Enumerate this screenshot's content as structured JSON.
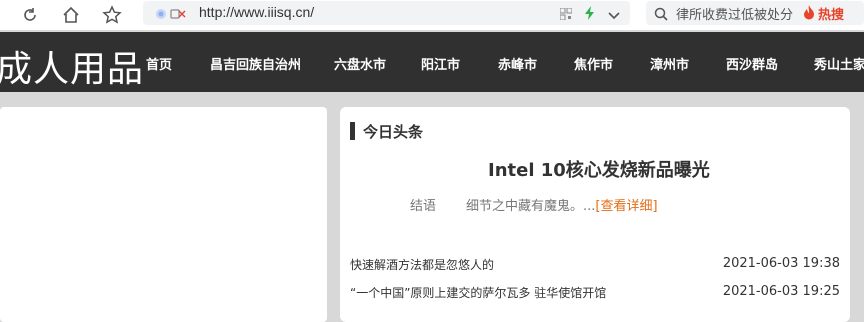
{
  "browser": {
    "url": "http://www.iiisq.cn/",
    "search_placeholder": "律所收费过低被处分",
    "hot_label": "热搜"
  },
  "site": {
    "logo": "成人用品",
    "nav": [
      "首页",
      "昌吉回族自治州",
      "六盘水市",
      "阳江市",
      "赤峰市",
      "焦作市",
      "漳州市",
      "西沙群岛",
      "秀山土家"
    ]
  },
  "news": {
    "section_title": "今日头条",
    "headline": "Intel 10核心发烧新品曝光",
    "author": "结语",
    "summary": "细节之中藏有魔鬼。...",
    "more_label": "[查看详细]",
    "items": [
      {
        "title": "快速解酒方法都是忽悠人的",
        "date": "2021-06-03 19:38"
      },
      {
        "title": "“一个中国”原则上建交的萨尔瓦多 驻华使馆开馆",
        "date": "2021-06-03 19:25"
      }
    ]
  },
  "colors": {
    "nav_bg": "#303030",
    "accent": "#e66c17",
    "hot": "#e8442c"
  }
}
